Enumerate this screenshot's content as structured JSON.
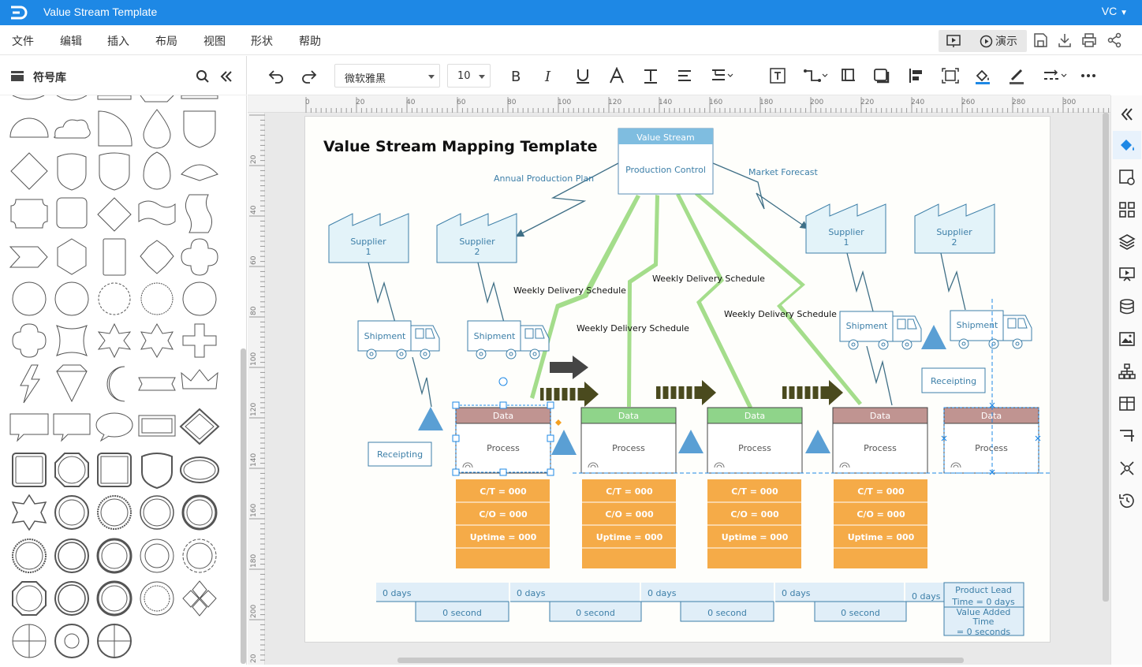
{
  "app": {
    "title": "Value Stream Template",
    "user": "VC"
  },
  "menu": [
    "文件",
    "编辑",
    "插入",
    "布局",
    "视图",
    "形状",
    "帮助"
  ],
  "header_actions": {
    "present_label": "演示"
  },
  "sidebar": {
    "title": "符号库"
  },
  "toolbar": {
    "font_family": "微软雅黑",
    "font_size": "10"
  },
  "ruler": {
    "h_ticks": [
      "0",
      "20",
      "40",
      "60",
      "80",
      "100",
      "120",
      "140",
      "160",
      "180",
      "200",
      "220",
      "240",
      "260",
      "280",
      "300"
    ],
    "v_ticks": [
      "20",
      "40",
      "60",
      "80",
      "100",
      "120",
      "140",
      "160",
      "180",
      "200",
      "20"
    ]
  },
  "diagram": {
    "title": "Value Stream Mapping Template",
    "control": {
      "header": "Value Stream",
      "body": "Production Control"
    },
    "edge_labels": {
      "annual": "Annual Production Plan",
      "market": "Market Forecast",
      "weekly1": "Weekly Delivery Schedule",
      "weekly2": "Weekly Delivery Schedule",
      "weekly3": "Weekly Delivery Schedule",
      "weekly4": "Weekly Delivery Schedule"
    },
    "suppliers_left": [
      {
        "line1": "Supplier",
        "line2": "1"
      },
      {
        "line1": "Supplier",
        "line2": "2"
      }
    ],
    "suppliers_right": [
      {
        "line1": "Supplier",
        "line2": "1"
      },
      {
        "line1": "Supplier",
        "line2": "2"
      }
    ],
    "shipment": "Shipment",
    "receipting": "Receipting",
    "process": {
      "header": "Data",
      "body": "Process",
      "ct": "C/T = 000",
      "co": "C/O = 000",
      "uptime": "Uptime = 000"
    },
    "timeline": {
      "days": "0 days",
      "seconds": "0 second",
      "lead_label": "Product Lead",
      "lead_value": "Time = 0 days",
      "va_label1": "Value Added",
      "va_label2": "Time",
      "va_value": "= 0 seconds"
    }
  },
  "colors": {
    "accent": "#1e88e5",
    "process_header_red": "#c09491",
    "process_header_green": "#8fd48a",
    "data_box": "#f5ab48",
    "supplier_fill": "#e3f3f9",
    "supplier_stroke": "#3d7fa8",
    "inventory": "#5a9fd4",
    "electronic_flow": "#a4dd8b",
    "push_arrow": "#4a4a1e"
  }
}
